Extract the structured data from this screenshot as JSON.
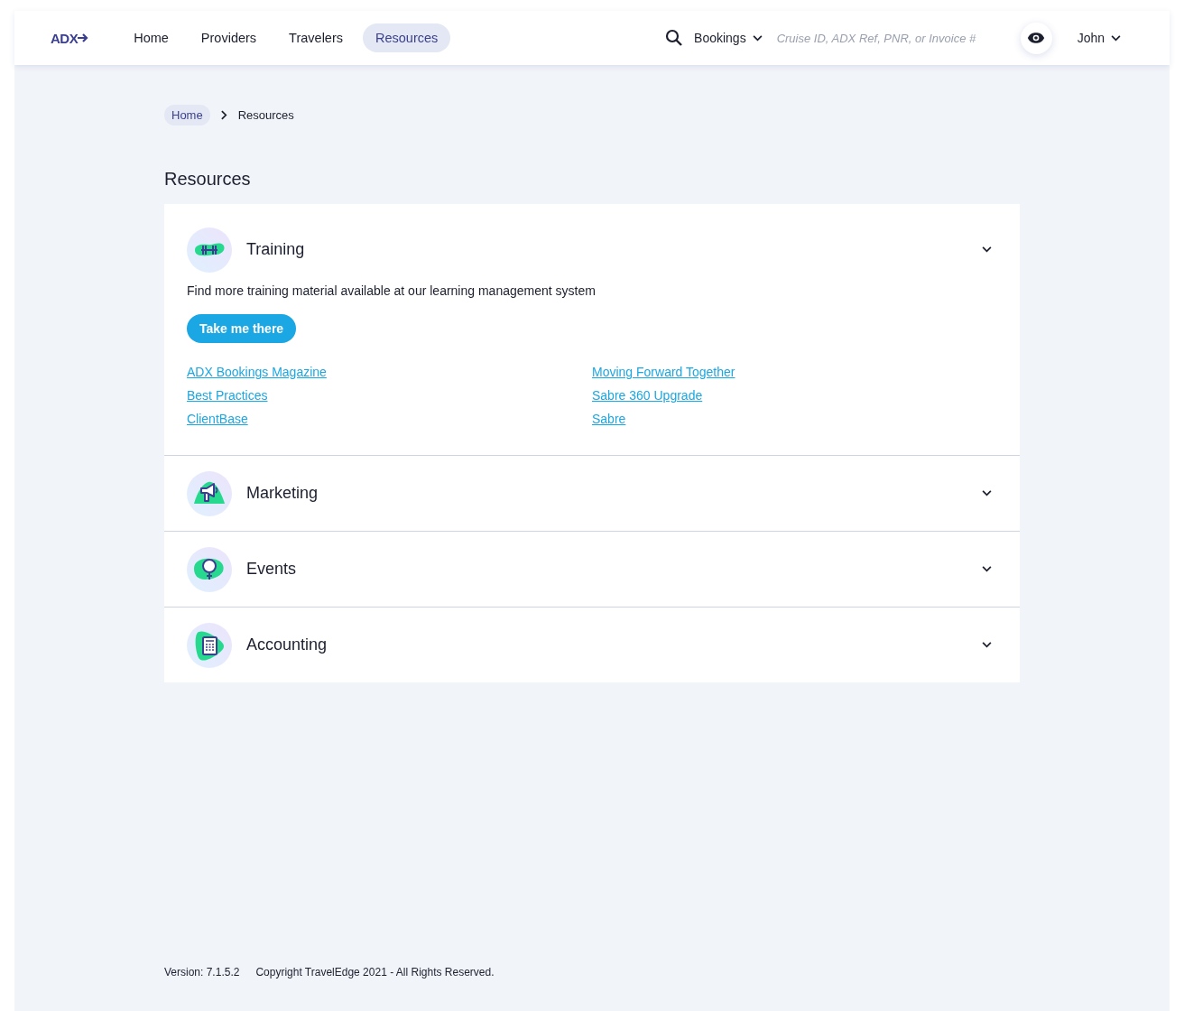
{
  "nav": {
    "logo": "ADX",
    "items": [
      {
        "label": "Home",
        "selected": false
      },
      {
        "label": "Providers",
        "selected": false
      },
      {
        "label": "Travelers",
        "selected": false
      },
      {
        "label": "Resources",
        "selected": true
      }
    ],
    "search_scope": "Bookings",
    "search": {
      "placeholder": "Cruise ID, ADX Ref, PNR, or Invoice #"
    },
    "user": "John"
  },
  "breadcrumb": [
    "Home",
    "Resources"
  ],
  "title": "Resources",
  "sections": [
    {
      "title": "Training",
      "expanded": true,
      "description": "Find more training material available at our learning management system",
      "button": "Take me there",
      "link_columns": [
        [
          "ADX Bookings Magazine",
          "Best Practices",
          "ClientBase"
        ],
        [
          "Moving Forward Together",
          "Sabre 360 Upgrade",
          "Sabre"
        ]
      ]
    },
    {
      "title": "Marketing",
      "expanded": false
    },
    {
      "title": "Events",
      "expanded": false
    },
    {
      "title": "Accounting",
      "expanded": false
    }
  ],
  "footer": {
    "version": "Version: 7.1.5.2",
    "copyright": "Copyright TravelEdge 2021 - All Rights Reserved."
  }
}
